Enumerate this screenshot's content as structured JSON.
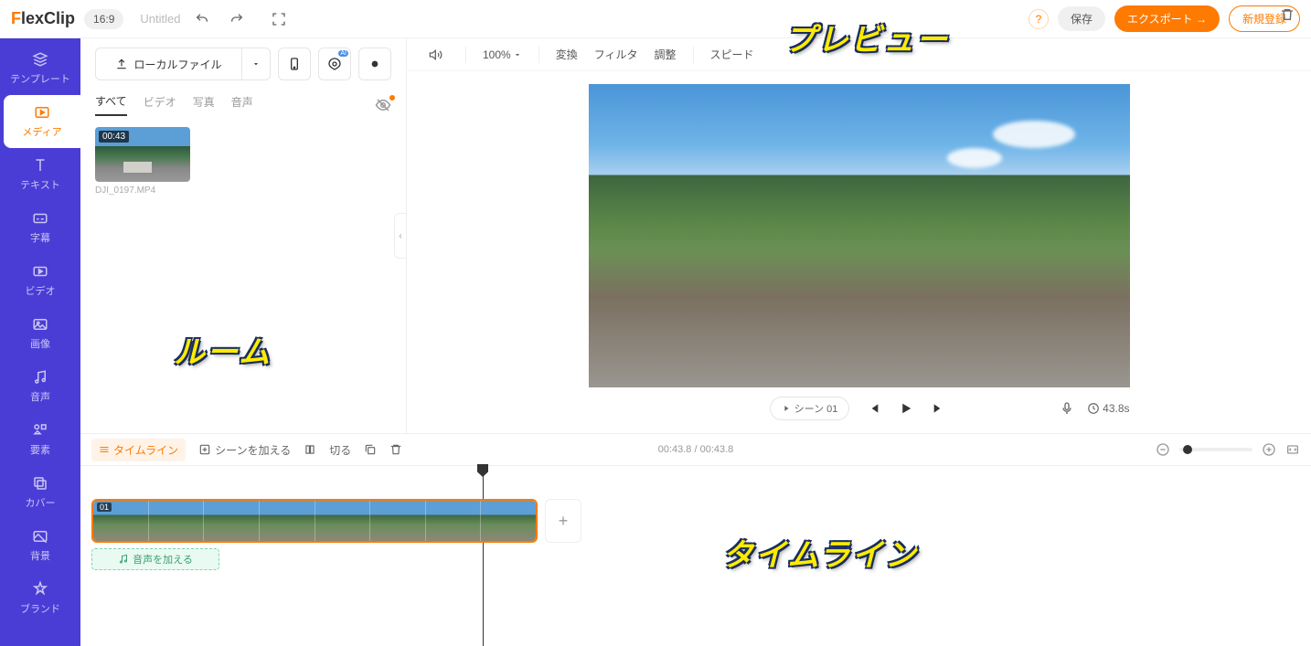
{
  "header": {
    "logo_prefix": "F",
    "logo_rest": "lexClip",
    "aspect": "16:9",
    "title": "Untitled",
    "save": "保存",
    "export": "エクスポート →",
    "signup": "新規登録"
  },
  "nav": {
    "templates": "テンプレート",
    "media": "メディア",
    "text": "テキスト",
    "subtitle": "字幕",
    "video": "ビデオ",
    "image": "画像",
    "audio": "音声",
    "element": "要素",
    "cover": "カバー",
    "background": "背景",
    "brand": "ブランド"
  },
  "media_panel": {
    "local_file": "ローカルファイル",
    "tabs": {
      "all": "すべて",
      "video": "ビデオ",
      "photo": "写真",
      "audio": "音声"
    },
    "thumb_duration": "00:43",
    "thumb_name": "DJI_0197.MP4"
  },
  "preview_toolbar": {
    "zoom": "100%",
    "transform": "変換",
    "filter": "フィルタ",
    "adjust": "調整",
    "speed": "スピード"
  },
  "controls": {
    "scene": "シーン 01",
    "duration": "43.8s"
  },
  "timeline": {
    "tab": "タイムライン",
    "add_scene": "シーンを加える",
    "cut": "切る",
    "time": "00:43.8 / 00:43.8",
    "clip_num": "01",
    "add_audio": "音声を加える"
  },
  "overlay": {
    "preview": "プレビュー",
    "room": "ルーム",
    "timeline_lbl": "タイムライン"
  }
}
